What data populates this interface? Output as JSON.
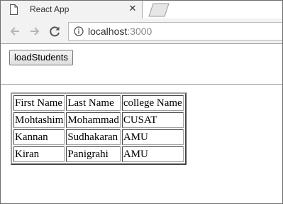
{
  "browser": {
    "tab_title": "React App",
    "tab_close_glyph": "✕",
    "url_host": "localhost",
    "url_port": ":3000",
    "icons": {
      "page": "page-icon",
      "close": "close-icon",
      "back": "back-arrow-icon",
      "forward": "forward-arrow-icon",
      "reload": "reload-icon",
      "info": "info-icon",
      "new_tab": "new-tab-icon"
    }
  },
  "page": {
    "load_button_label": "loadStudents",
    "table": {
      "headers": [
        "First Name",
        "Last Name",
        "college Name"
      ],
      "rows": [
        [
          "Mohtashim",
          "Mohammad",
          "CUSAT"
        ],
        [
          "Kannan",
          "Sudhakaran",
          "AMU"
        ],
        [
          "Kiran",
          "Panigrahi",
          "AMU"
        ]
      ]
    }
  }
}
